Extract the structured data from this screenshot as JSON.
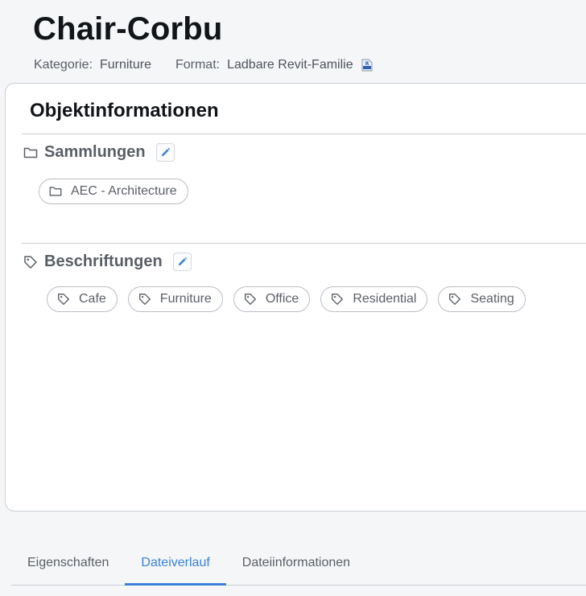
{
  "header": {
    "title": "Chair-Corbu",
    "category_label": "Kategorie:",
    "category_value": "Furniture",
    "format_label": "Format:",
    "format_value": "Ladbare Revit-Familie",
    "format_icon": "revit-file-icon"
  },
  "card": {
    "title": "Objektinformationen",
    "collections": {
      "label": "Sammlungen",
      "icon": "folder-icon",
      "edit_icon": "pencil-icon",
      "items": [
        "AEC - Architecture"
      ]
    },
    "tags": {
      "label": "Beschriftungen",
      "icon": "tag-icon",
      "edit_icon": "pencil-icon",
      "items": [
        "Cafe",
        "Furniture",
        "Office",
        "Residential",
        "Seating"
      ]
    }
  },
  "tabs": {
    "items": [
      "Eigenschaften",
      "Dateiverlauf",
      "Dateiinformationen"
    ],
    "active": "Dateiverlauf"
  },
  "colors": {
    "accent": "#3b82d6",
    "text_muted": "#5a5f66",
    "border": "#c9cdd2",
    "background": "#f5f6f8"
  }
}
